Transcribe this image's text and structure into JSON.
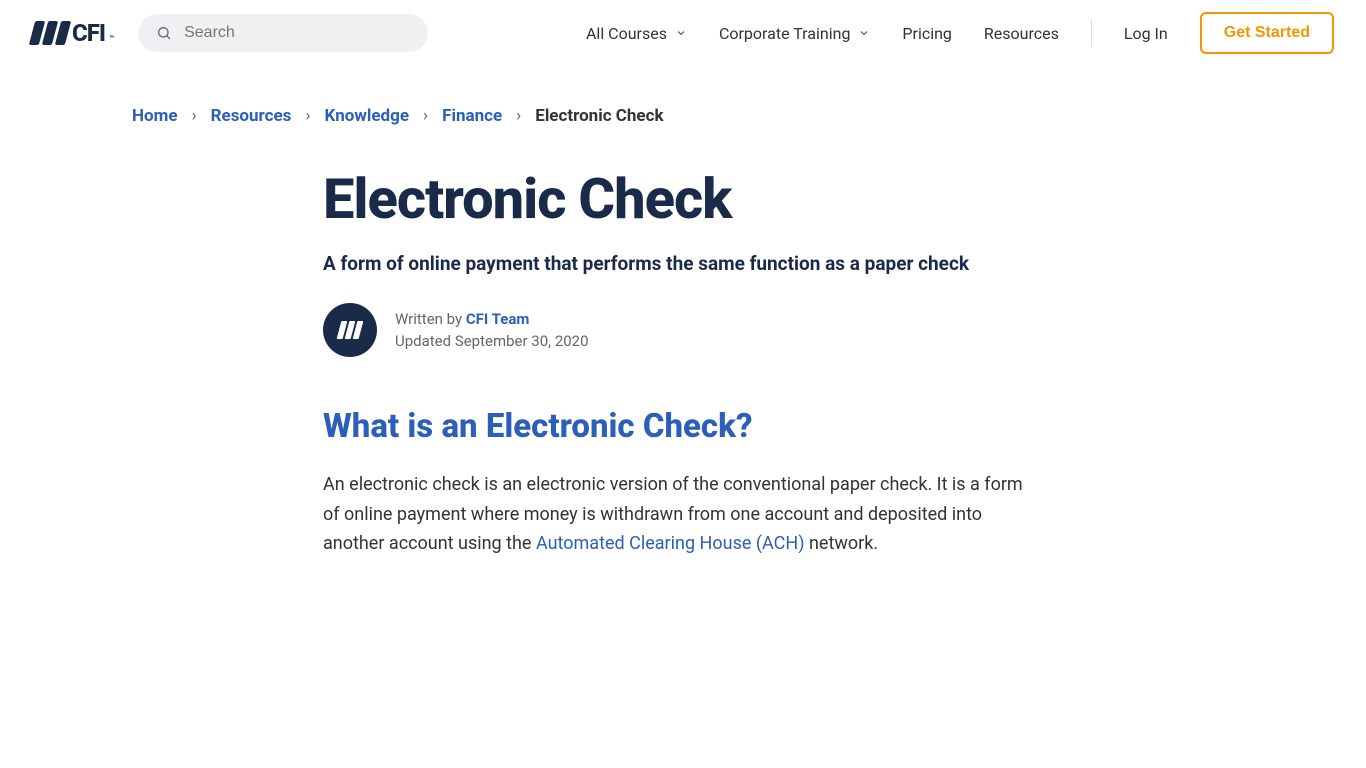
{
  "header": {
    "logo_text": "CFI",
    "search_placeholder": "Search",
    "nav": {
      "all_courses": "All Courses",
      "corporate_training": "Corporate Training",
      "pricing": "Pricing",
      "resources": "Resources",
      "log_in": "Log In",
      "get_started": "Get Started"
    }
  },
  "breadcrumb": {
    "items": [
      {
        "label": "Home"
      },
      {
        "label": "Resources"
      },
      {
        "label": "Knowledge"
      },
      {
        "label": "Finance"
      }
    ],
    "current": "Electronic Check"
  },
  "article": {
    "title": "Electronic Check",
    "subtitle": "A form of online payment that performs the same function as a paper check",
    "written_by_prefix": "Written by ",
    "author": "CFI Team",
    "updated_prefix": "Updated ",
    "updated_date": "September 30, 2020",
    "section_heading": "What is an Electronic Check?",
    "body_pre": "An electronic check is an electronic version of the conventional paper check. It is a form of online payment where money is withdrawn from one account and deposited into another account using the ",
    "body_link": "Automated Clearing House (ACH)",
    "body_post": " network."
  }
}
